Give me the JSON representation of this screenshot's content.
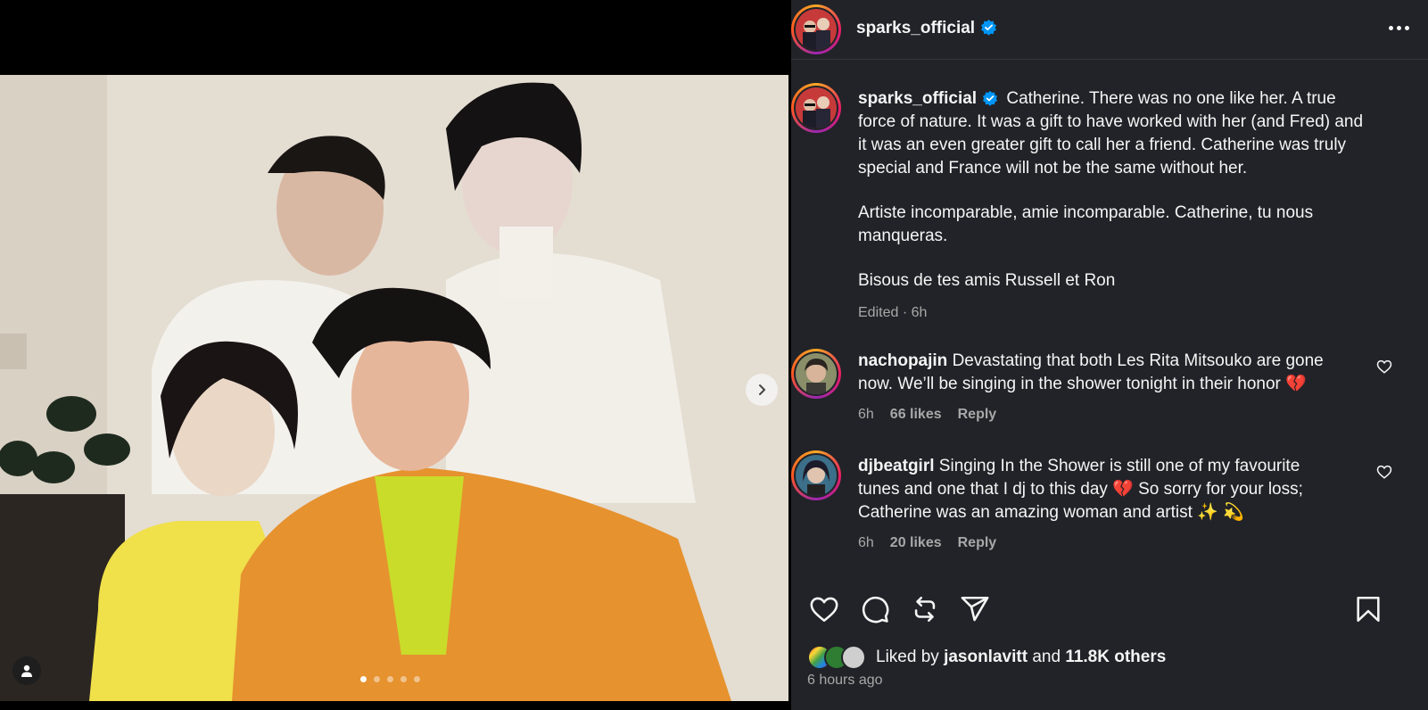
{
  "post": {
    "username": "sparks_official",
    "caption_paragraphs": [
      "Catherine. There was no one like her. A true force of nature. It was a gift to have worked with her (and Fred) and it was an even greater gift to call her a friend. Catherine was truly special and France will not be the same without her.",
      "Artiste incomparable, amie incomparable. Catherine, tu nous manqueras.",
      "Bisous de tes amis Russell et Ron"
    ],
    "caption_meta": "Edited · 6h"
  },
  "comments": [
    {
      "username": "nachopajin",
      "text": "Devastating that both Les Rita Mitsouko are gone now. We’ll be singing in the shower tonight in their honor 💔",
      "time": "6h",
      "likes": "66 likes",
      "reply": "Reply"
    },
    {
      "username": "djbeatgirl",
      "text": "Singing In the Shower is still one of my favourite tunes and one that I dj to this day 💔  So sorry for your loss; Catherine was an amazing woman and artist ✨ 💫",
      "time": "6h",
      "likes": "20 likes",
      "reply": "Reply"
    }
  ],
  "footer": {
    "liked_prefix": "Liked by",
    "liked_user": "jasonlavitt",
    "liked_and": "and",
    "liked_count": "11.8K others",
    "time_ago": "6 hours ago"
  },
  "carousel": {
    "current": 1,
    "total": 5
  },
  "icons": {
    "verified": "verified-badge-icon",
    "more": "more-options-icon",
    "like": "heart-icon",
    "comment": "comment-icon",
    "repost": "repost-icon",
    "share": "share-icon",
    "save": "bookmark-icon",
    "next": "chevron-right-icon",
    "tag": "user-tag-icon"
  },
  "colors": {
    "verified": "#0095f6",
    "panel_bg": "#212328",
    "muted": "#a8a8a8",
    "text": "#f5f5f5"
  }
}
